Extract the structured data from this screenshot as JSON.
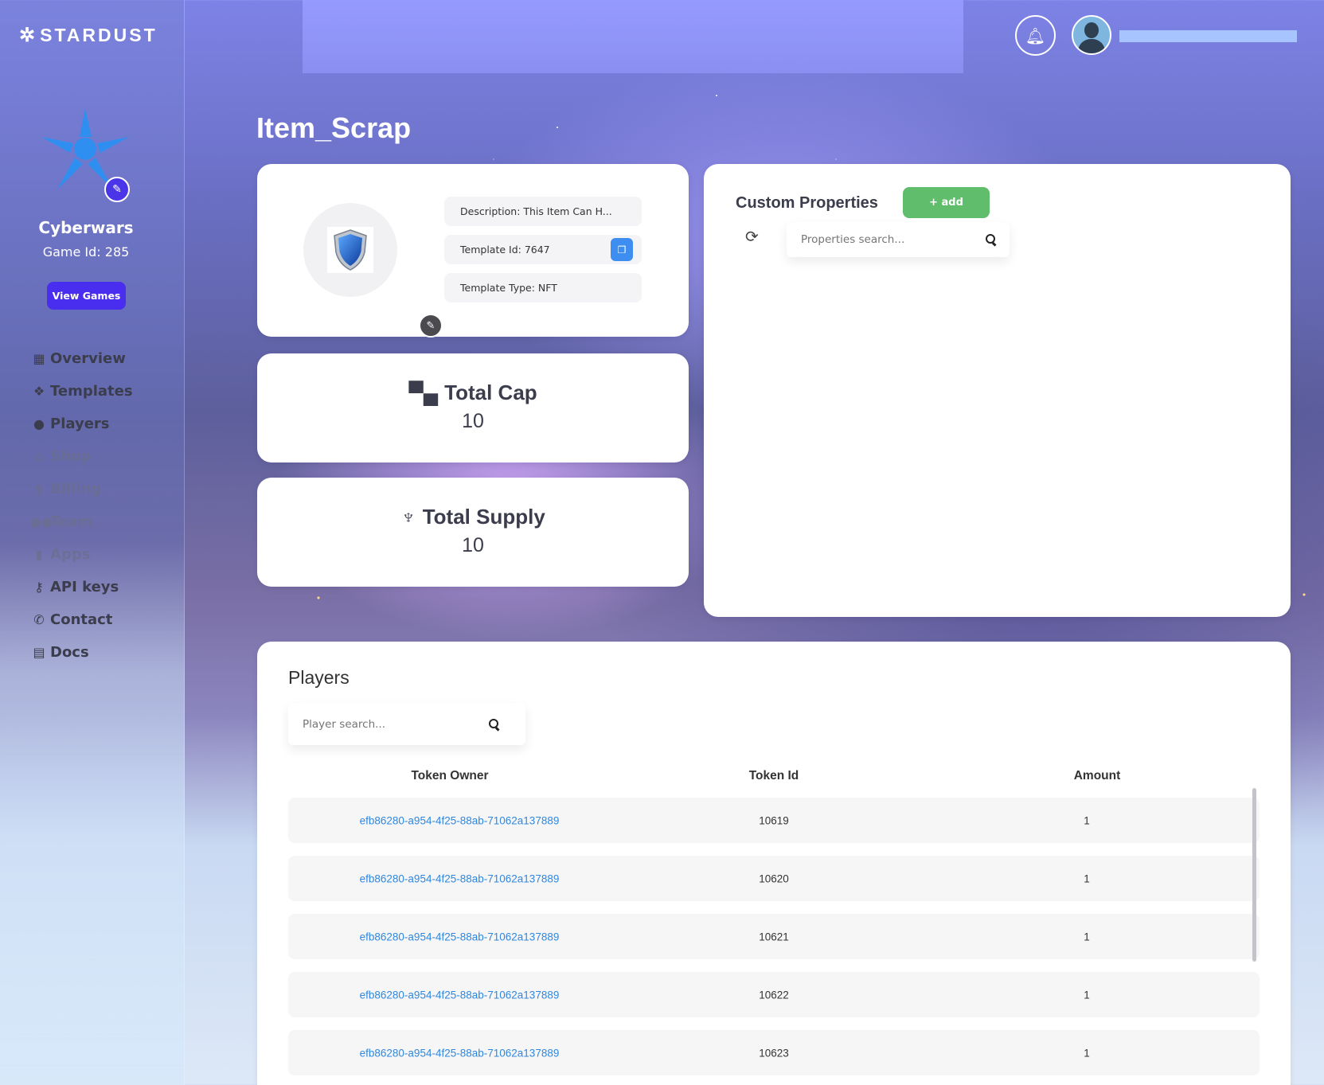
{
  "brand": {
    "name": "STARDUST"
  },
  "sidebar": {
    "game_name": "Cyberwars",
    "game_id": "Game Id: 285",
    "view_games_label": "View Games",
    "nav": [
      {
        "label": "Overview",
        "icon": "grid-icon",
        "enabled": true
      },
      {
        "label": "Templates",
        "icon": "cubes-icon",
        "enabled": true
      },
      {
        "label": "Players",
        "icon": "user-icon",
        "enabled": true
      },
      {
        "label": "Shop",
        "icon": "store-icon",
        "enabled": false
      },
      {
        "label": "Billing",
        "icon": "dollar-icon",
        "enabled": false
      },
      {
        "label": "Team",
        "icon": "users-icon",
        "enabled": false
      },
      {
        "label": "Apps",
        "icon": "mobile-icon",
        "enabled": false
      },
      {
        "label": "API keys",
        "icon": "key-icon",
        "enabled": true
      },
      {
        "label": "Contact",
        "icon": "phone-icon",
        "enabled": true
      },
      {
        "label": "Docs",
        "icon": "file-icon",
        "enabled": true
      }
    ]
  },
  "header": {
    "username": ""
  },
  "page": {
    "title": "Item_Scrap"
  },
  "item": {
    "description": "Description: This Item Can H...",
    "template_id": "Template Id: 7647",
    "template_type": "Template Type: NFT"
  },
  "stats": {
    "total_cap_label": "Total Cap",
    "total_cap_value": "10",
    "total_supply_label": "Total Supply",
    "total_supply_value": "10"
  },
  "custom_properties": {
    "title": "Custom Properties",
    "add_label": "+ add",
    "search_placeholder": "Properties search..."
  },
  "players": {
    "title": "Players",
    "search_placeholder": "Player search...",
    "columns": [
      "Token Owner",
      "Token Id",
      "Amount"
    ],
    "rows": [
      {
        "owner": "efb86280-a954-4f25-88ab-71062a137889",
        "token_id": "10619",
        "amount": "1"
      },
      {
        "owner": "efb86280-a954-4f25-88ab-71062a137889",
        "token_id": "10620",
        "amount": "1"
      },
      {
        "owner": "efb86280-a954-4f25-88ab-71062a137889",
        "token_id": "10621",
        "amount": "1"
      },
      {
        "owner": "efb86280-a954-4f25-88ab-71062a137889",
        "token_id": "10622",
        "amount": "1"
      },
      {
        "owner": "efb86280-a954-4f25-88ab-71062a137889",
        "token_id": "10623",
        "amount": "1"
      }
    ]
  },
  "colors": {
    "accent": "#4a2ef0",
    "add_button": "#5fbd6b",
    "copy_button": "#3d8ef0",
    "link": "#2f88e0"
  }
}
